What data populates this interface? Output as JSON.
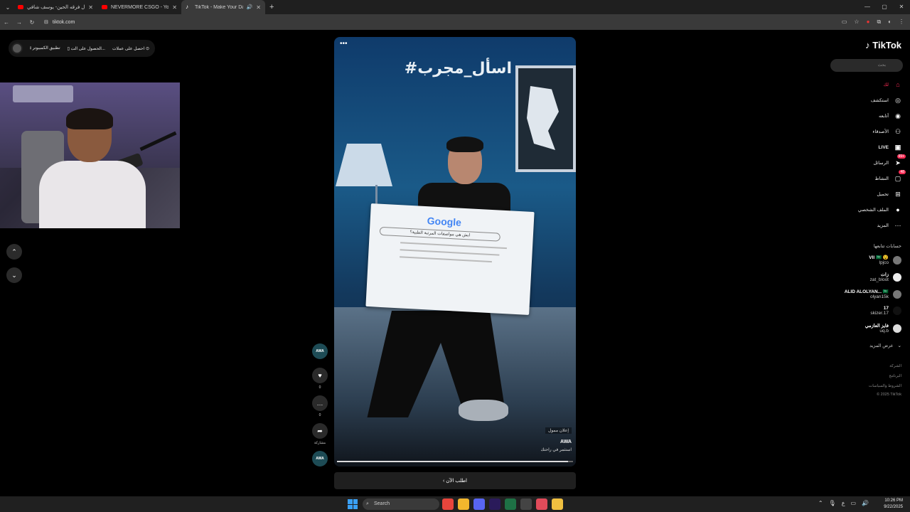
{
  "browser": {
    "tabs": [
      {
        "title": "يا سال فرقه الحين- يوسف شافي",
        "active": false,
        "audio": false
      },
      {
        "title": "NEVERMORE CSGO - YouTube",
        "active": false,
        "audio": false
      },
      {
        "title": "TikTok - Make Your Day",
        "active": true,
        "audio": true
      }
    ],
    "url": "tiktok.com"
  },
  "promo": {
    "item1": "احصل على عملات",
    "item2": "الحصول على الت...",
    "item3": "تطبيق الكمبيوتر"
  },
  "video": {
    "hashtag": "#اسأل_مجرب",
    "board_brand": "Google",
    "board_query": "ايش هي مواصفات المرتبة الطبية؟",
    "sponsored_label": "إعلان ممول",
    "author": "AWA",
    "description": "استثمر في راحتك",
    "progress": 0.98,
    "cta_label": "اطلب الآن"
  },
  "actions": {
    "avatar_label": "AWA",
    "likes": "0",
    "comments": "0",
    "share_label": "مشاركة",
    "music_label": "AWA"
  },
  "sidebar": {
    "logo": "TikTok",
    "search_placeholder": "بحث",
    "nav": [
      {
        "label": "لك",
        "icon": "home-icon"
      },
      {
        "label": "استكشف",
        "icon": "compass-icon"
      },
      {
        "label": "أتابعه",
        "icon": "following-icon"
      },
      {
        "label": "الأصدقاء",
        "icon": "friends-icon"
      },
      {
        "label": "LIVE",
        "icon": "live-icon"
      },
      {
        "label": "الرسائل",
        "icon": "messages-icon",
        "badge": "99+"
      },
      {
        "label": "النشاط",
        "icon": "activity-icon",
        "badge": "48"
      },
      {
        "label": "تحميل",
        "icon": "upload-icon"
      },
      {
        "label": "الملف الشخصي",
        "icon": "profile-icon"
      },
      {
        "label": "المزيد",
        "icon": "more-icon"
      }
    ],
    "following_header": "حسابات تتابعها",
    "accounts": [
      {
        "name": "Vll 🇸🇦 😵",
        "user": "lpjco"
      },
      {
        "name": "زات",
        "user": "zat_bloot"
      },
      {
        "name": "ALID ALOLYAN... 🇸🇦",
        "user": "olyan15k"
      },
      {
        "name": "17",
        "user": "skizer.17"
      },
      {
        "name": "فايز العازمي",
        "user": "uq.b"
      }
    ],
    "see_more": "عرض المزيد",
    "footer": [
      "الشركة",
      "البرنامج",
      "الشروط والسياسات",
      "© 2025 TikTok"
    ]
  },
  "taskbar": {
    "search_label": "Search",
    "time": "10:26 PM",
    "date": "9/22/2025",
    "lang": "ع"
  },
  "colors": {
    "accent": "#fe2c55",
    "background": "#000000",
    "taskbar": "#202020"
  }
}
